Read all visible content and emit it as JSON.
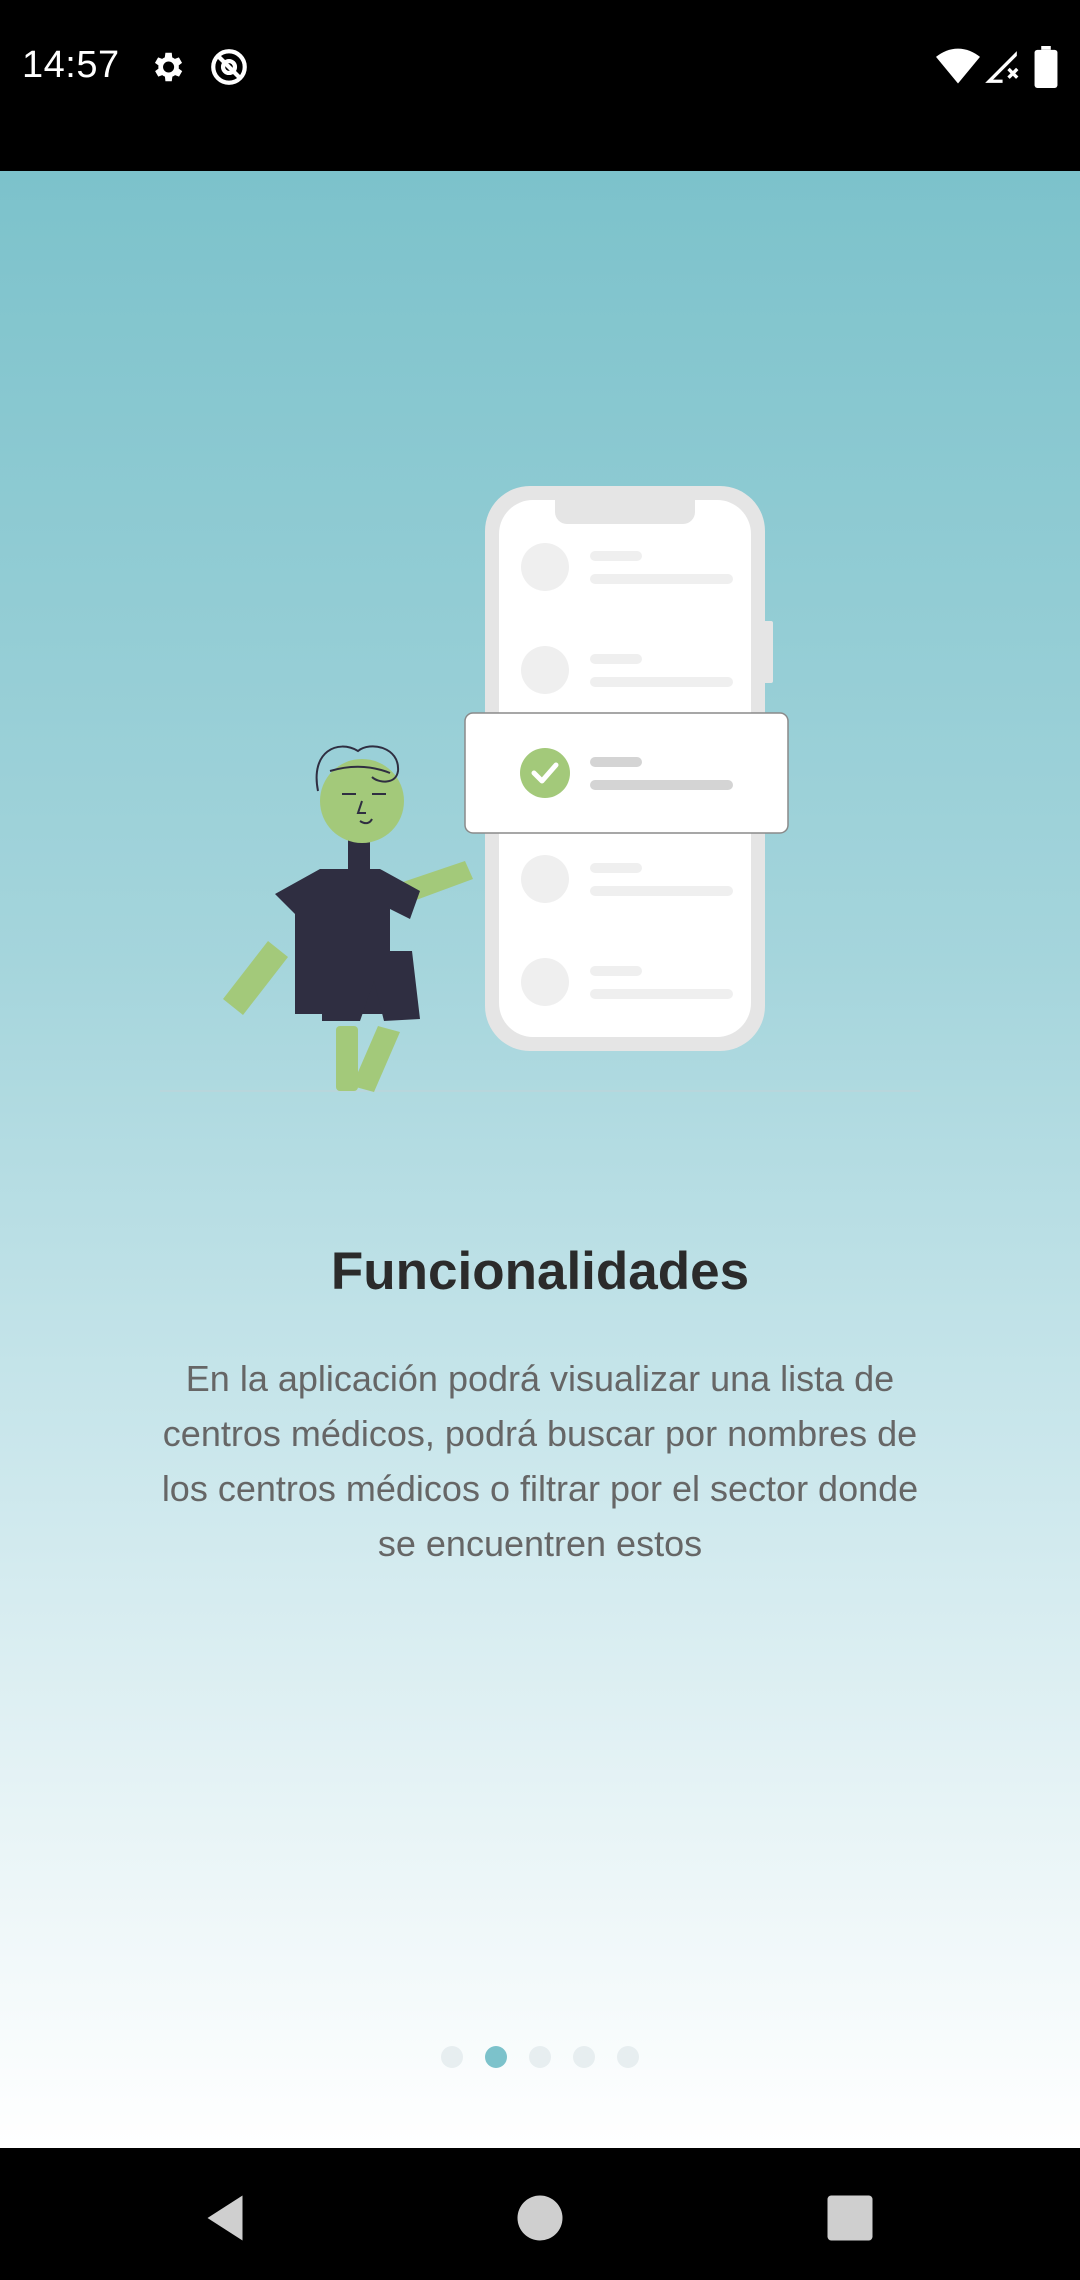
{
  "status_bar": {
    "time": "14:57",
    "left_icons": [
      "gear-icon",
      "at-sign-icon"
    ],
    "right_icons": [
      "wifi-icon",
      "cellular-signal-no-service-icon",
      "battery-icon"
    ]
  },
  "onboarding": {
    "title": "Funcionalidades",
    "description": "En la aplicación podrá visualizar una lista de centros médicos, podrá buscar por nombres de los centros médicos o filtrar por el sector donde se encuentren estos",
    "page_indicator": {
      "total_pages": 5,
      "current_page": 2
    }
  },
  "colors": {
    "accent": "#7cc2cb",
    "check_green": "#a3c97a",
    "figure_dark": "#2f2e41",
    "text_title": "#2b2b2b",
    "text_body": "#666666"
  },
  "nav_bar": {
    "buttons": [
      "back-icon",
      "home-icon",
      "recents-icon"
    ]
  }
}
